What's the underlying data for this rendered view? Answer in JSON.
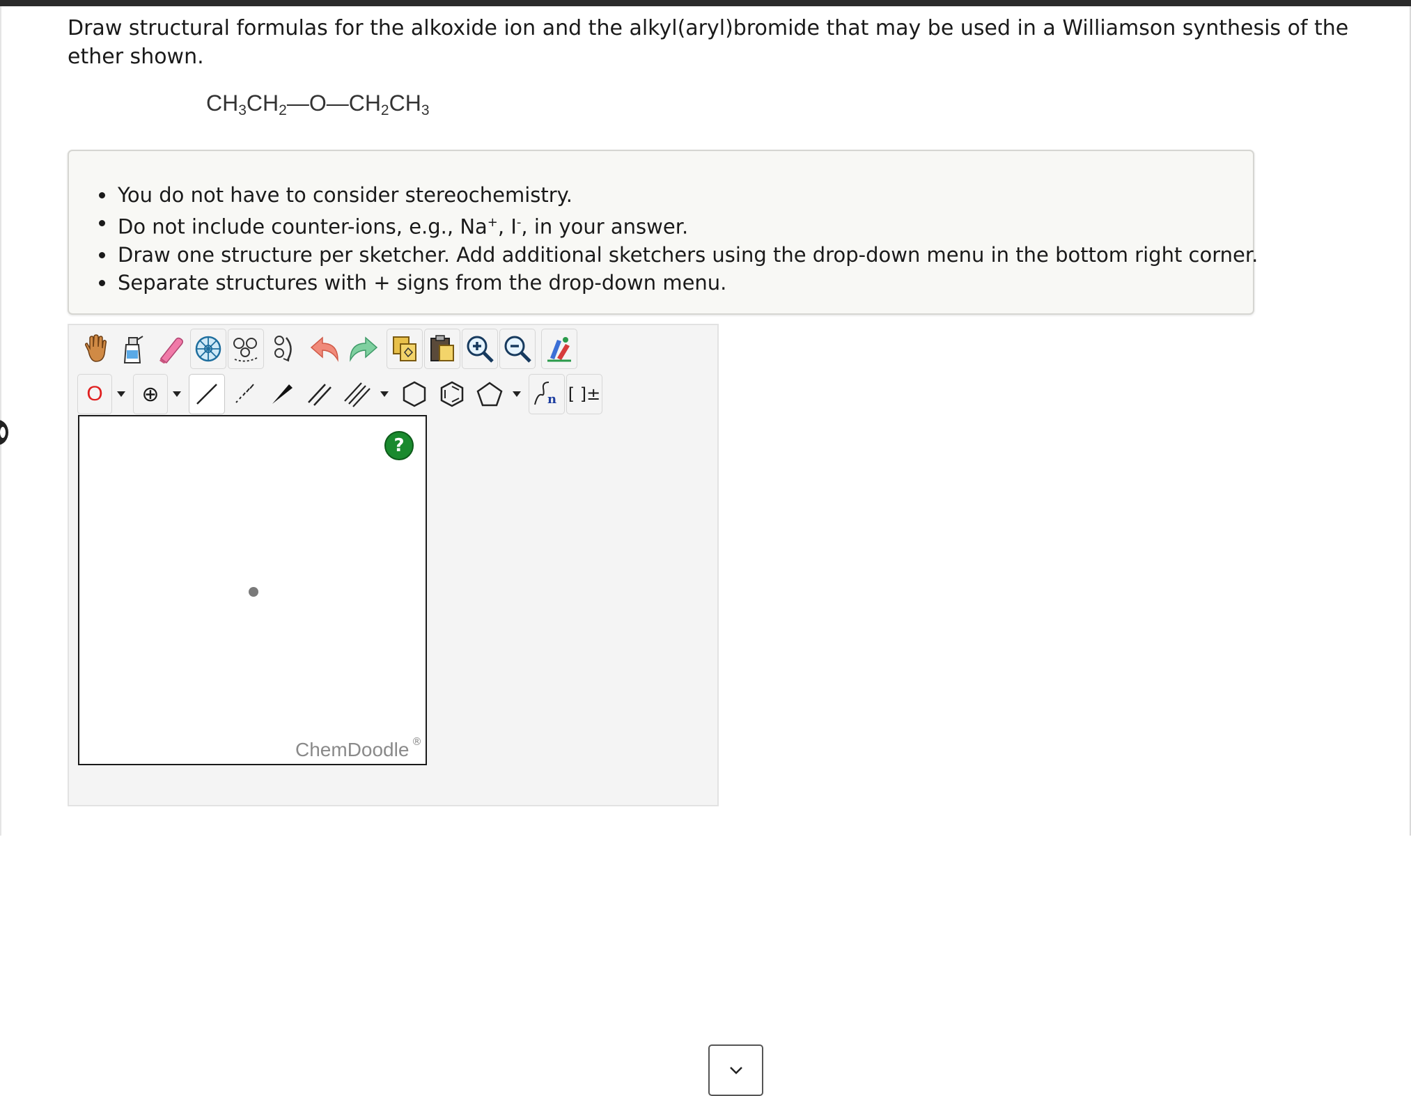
{
  "question": {
    "text": "Draw structural formulas for the alkoxide ion and the alkyl(aryl)bromide that may be used in a Williamson synthesis of the ether shown."
  },
  "formula": {
    "left_main": "CH",
    "sub3": "3",
    "mid": "CH",
    "sub2": "2",
    "bond1": "—",
    "oxygen": "O",
    "bond2": "—",
    "right_a": "CH",
    "sub2b": "2",
    "right_b": "CH",
    "sub3b": "3"
  },
  "instructions": {
    "item1": "You do not have to consider stereochemistry.",
    "item2_a": "Do not include counter-ions, e.g., Na",
    "item2_sup1": "+",
    "item2_b": ", I",
    "item2_sup2": "-",
    "item2_c": ", in your answer.",
    "item3": "Draw one structure per sketcher. Add additional sketchers using the drop-down menu in the bottom right corner.",
    "item4": "Separate structures with + signs from the drop-down menu."
  },
  "toolbar": {
    "atom_label": "O",
    "charge_label": "⊕",
    "bracket_label": "[ ]±"
  },
  "canvas": {
    "help_label": "?",
    "brand": "ChemDoodle",
    "brand_reg": "®"
  },
  "colors": {
    "atom_red": "#e02020",
    "help_green": "#1a8a2e",
    "brand_gray": "#8a8a8a"
  }
}
